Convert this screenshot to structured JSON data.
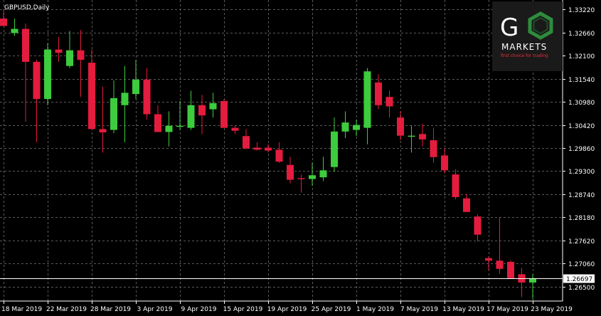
{
  "chart_data": {
    "type": "candlestick",
    "title": "GBPUSD,Daily",
    "ylim": [
      1.2615,
      1.3345
    ],
    "y_ticks": [
      "1.33220",
      "1.32660",
      "1.32100",
      "1.31540",
      "1.30980",
      "1.30420",
      "1.29860",
      "1.29300",
      "1.28740",
      "1.28180",
      "1.27620",
      "1.27060",
      "1.26500"
    ],
    "x_ticks": [
      "18 Mar 2019",
      "22 Mar 2019",
      "28 Mar 2019",
      "3 Apr 2019",
      "9 Apr 2019",
      "15 Apr 2019",
      "19 Apr 2019",
      "25 Apr 2019",
      "1 May 2019",
      "7 May 2019",
      "13 May 2019",
      "17 May 2019",
      "23 May 2019"
    ],
    "x_tick_candle_index": [
      0,
      4,
      8,
      12,
      16,
      20,
      24,
      28,
      32,
      36,
      40,
      44,
      48
    ],
    "current_price": 1.26697,
    "colors": {
      "bull": "#3dcc3d",
      "bear": "#e41c3e",
      "grid": "#5a5a5a",
      "axis": "#ffffff",
      "background": "#000000"
    },
    "candles": [
      {
        "o": 1.33,
        "h": 1.332,
        "l": 1.3282,
        "c": 1.3282
      },
      {
        "o": 1.3265,
        "h": 1.33,
        "l": 1.3258,
        "c": 1.3275
      },
      {
        "o": 1.3275,
        "h": 1.3288,
        "l": 1.305,
        "c": 1.3195
      },
      {
        "o": 1.3195,
        "h": 1.32,
        "l": 1.3,
        "c": 1.3105
      },
      {
        "o": 1.3105,
        "h": 1.324,
        "l": 1.309,
        "c": 1.3225
      },
      {
        "o": 1.3225,
        "h": 1.3255,
        "l": 1.3195,
        "c": 1.3217
      },
      {
        "o": 1.3185,
        "h": 1.327,
        "l": 1.318,
        "c": 1.3223
      },
      {
        "o": 1.3223,
        "h": 1.3272,
        "l": 1.311,
        "c": 1.32
      },
      {
        "o": 1.3193,
        "h": 1.3225,
        "l": 1.3032,
        "c": 1.3032
      },
      {
        "o": 1.3032,
        "h": 1.3135,
        "l": 1.2975,
        "c": 1.3024
      },
      {
        "o": 1.303,
        "h": 1.315,
        "l": 1.3022,
        "c": 1.3107
      },
      {
        "o": 1.309,
        "h": 1.3185,
        "l": 1.3,
        "c": 1.312
      },
      {
        "o": 1.3117,
        "h": 1.32,
        "l": 1.3105,
        "c": 1.3152
      },
      {
        "o": 1.3152,
        "h": 1.318,
        "l": 1.3055,
        "c": 1.3068
      },
      {
        "o": 1.3068,
        "h": 1.309,
        "l": 1.3025,
        "c": 1.3025
      },
      {
        "o": 1.3025,
        "h": 1.3075,
        "l": 1.299,
        "c": 1.304
      },
      {
        "o": 1.304,
        "h": 1.31,
        "l": 1.303,
        "c": 1.304
      },
      {
        "o": 1.3035,
        "h": 1.3125,
        "l": 1.303,
        "c": 1.309
      },
      {
        "o": 1.309,
        "h": 1.3115,
        "l": 1.302,
        "c": 1.3065
      },
      {
        "o": 1.308,
        "h": 1.312,
        "l": 1.306,
        "c": 1.3095
      },
      {
        "o": 1.31,
        "h": 1.3105,
        "l": 1.3035,
        "c": 1.3035
      },
      {
        "o": 1.3035,
        "h": 1.304,
        "l": 1.302,
        "c": 1.3028
      },
      {
        "o": 1.3015,
        "h": 1.3032,
        "l": 1.2983,
        "c": 1.2985
      },
      {
        "o": 1.2987,
        "h": 1.3,
        "l": 1.298,
        "c": 1.2982
      },
      {
        "o": 1.2987,
        "h": 1.2995,
        "l": 1.2975,
        "c": 1.298
      },
      {
        "o": 1.2982,
        "h": 1.3,
        "l": 1.295,
        "c": 1.2953
      },
      {
        "o": 1.2945,
        "h": 1.2965,
        "l": 1.29,
        "c": 1.2909
      },
      {
        "o": 1.2913,
        "h": 1.2922,
        "l": 1.2878,
        "c": 1.2911
      },
      {
        "o": 1.2911,
        "h": 1.295,
        "l": 1.2895,
        "c": 1.292
      },
      {
        "o": 1.2915,
        "h": 1.2965,
        "l": 1.2906,
        "c": 1.2932
      },
      {
        "o": 1.294,
        "h": 1.306,
        "l": 1.2928,
        "c": 1.3026
      },
      {
        "o": 1.3026,
        "h": 1.3075,
        "l": 1.301,
        "c": 1.3048
      },
      {
        "o": 1.303,
        "h": 1.3055,
        "l": 1.3015,
        "c": 1.3042
      },
      {
        "o": 1.3035,
        "h": 1.318,
        "l": 1.2995,
        "c": 1.3172
      },
      {
        "o": 1.3145,
        "h": 1.3165,
        "l": 1.308,
        "c": 1.309
      },
      {
        "o": 1.311,
        "h": 1.3125,
        "l": 1.306,
        "c": 1.3087
      },
      {
        "o": 1.306,
        "h": 1.3075,
        "l": 1.3005,
        "c": 1.3016
      },
      {
        "o": 1.3015,
        "h": 1.304,
        "l": 1.2975,
        "c": 1.3016
      },
      {
        "o": 1.302,
        "h": 1.3045,
        "l": 1.299,
        "c": 1.3007
      },
      {
        "o": 1.3005,
        "h": 1.3035,
        "l": 1.295,
        "c": 1.2964
      },
      {
        "o": 1.2968,
        "h": 1.2985,
        "l": 1.2925,
        "c": 1.2932
      },
      {
        "o": 1.2922,
        "h": 1.2935,
        "l": 1.2862,
        "c": 1.2867
      },
      {
        "o": 1.2864,
        "h": 1.2875,
        "l": 1.283,
        "c": 1.2831
      },
      {
        "o": 1.282,
        "h": 1.2825,
        "l": 1.276,
        "c": 1.2776
      },
      {
        "o": 1.2719,
        "h": 1.2723,
        "l": 1.269,
        "c": 1.2713
      },
      {
        "o": 1.2713,
        "h": 1.2818,
        "l": 1.2681,
        "c": 1.2693
      },
      {
        "o": 1.271,
        "h": 1.2714,
        "l": 1.267,
        "c": 1.267
      },
      {
        "o": 1.268,
        "h": 1.2695,
        "l": 1.2625,
        "c": 1.266
      },
      {
        "o": 1.266,
        "h": 1.268,
        "l": 1.262,
        "c": 1.267
      }
    ]
  },
  "logo": {
    "brand_g": "G",
    "brand_name": "MARKETS",
    "tagline": "first choice for trading"
  }
}
